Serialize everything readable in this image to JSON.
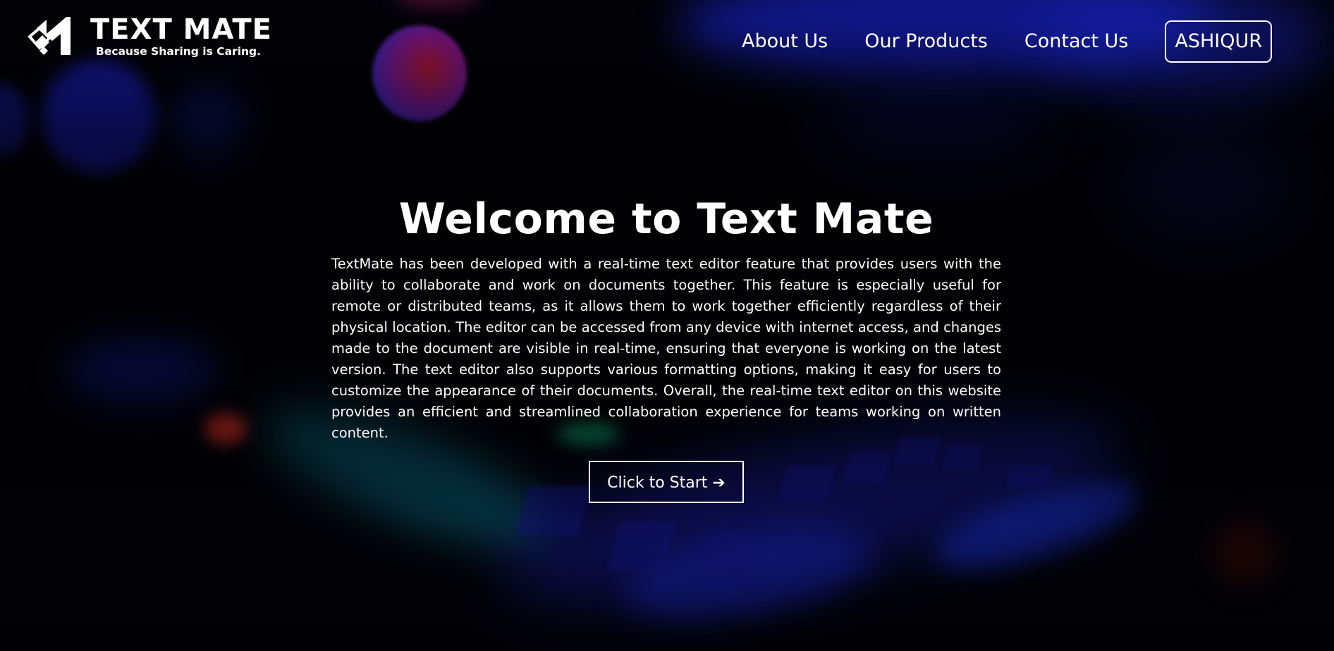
{
  "brand": {
    "logo_icon": "textmate-logo-icon",
    "name": "TEXT MATE",
    "tagline": "Because Sharing is Caring."
  },
  "nav": {
    "about": "About Us",
    "products": "Our Products",
    "contact": "Contact Us",
    "user": "ASHIQUR"
  },
  "hero": {
    "title": "Welcome to Text Mate",
    "body": "TextMate has been developed with a real-time text editor feature that provides users with the ability to collaborate and work on documents together. This feature is especially useful for remote or distributed teams, as it allows them to work together efficiently regardless of their physical location. The editor can be accessed from any device with internet access, and changes made to the document are visible in real-time, ensuring that everyone is working on the latest version. The text editor also supports various formatting options, making it easy for users to customize the appearance of their documents. Overall, the real-time text editor on this website provides an efficient and streamlined collaboration experience for teams working on written content.",
    "cta": "Click to Start ➔"
  },
  "colors": {
    "text": "#ffffff",
    "background": "#020208",
    "glow_blue": "#1a24d8",
    "glow_cyan": "#0c8fae",
    "glow_red": "#c41a3a"
  }
}
